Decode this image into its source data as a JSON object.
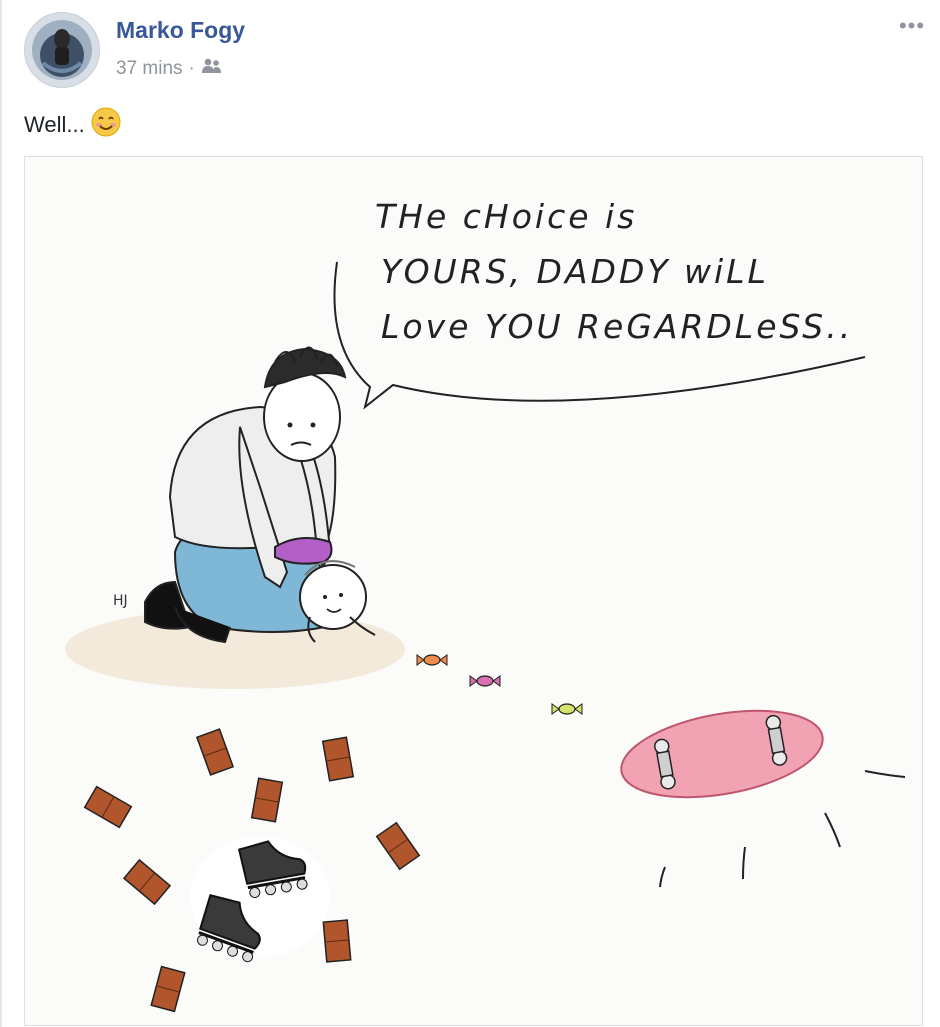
{
  "post": {
    "author": "Marko Fogy",
    "time": "37 mins",
    "separator": "·",
    "audience_icon": "friends-icon",
    "more_icon": "more-options-icon",
    "more_glyph": "•••",
    "caption_text": "Well...",
    "caption_emoji": "smiling-face-emoji"
  },
  "cartoon": {
    "speech_line1": "THe cHoice is",
    "speech_line2": "YOURS, DADDY wiLL",
    "speech_line3": "Love YOU ReGARDLeSS..",
    "signature": "HJ"
  },
  "colors": {
    "link_blue": "#385898",
    "meta_grey": "#90949c",
    "skateboard_pink": "#f2a3b3",
    "jeans_blue": "#7fb7d6",
    "diaper_purple": "#b25fc8",
    "chocolate_brown": "#b0552c"
  }
}
